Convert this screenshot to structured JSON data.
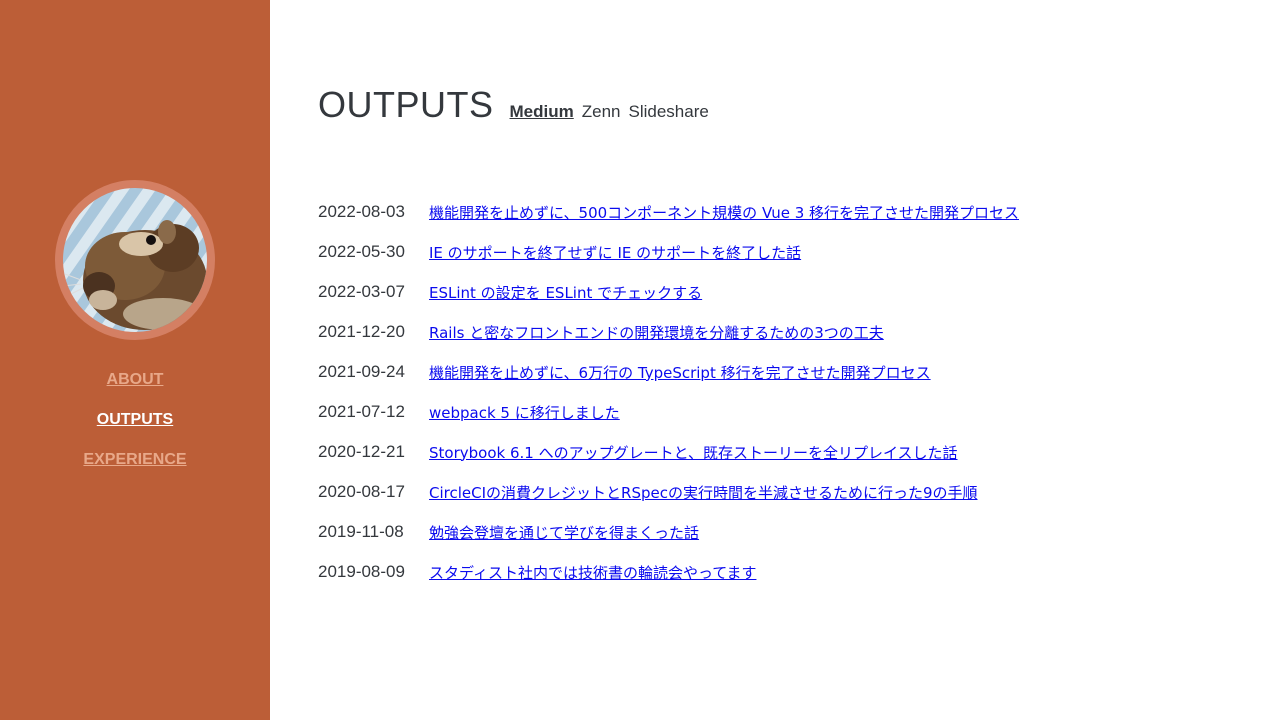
{
  "sidebar": {
    "avatar_alt": "avatar",
    "nav": [
      {
        "label": "ABOUT",
        "active": false
      },
      {
        "label": "OUTPUTS",
        "active": true
      },
      {
        "label": "EXPERIENCE",
        "active": false
      }
    ]
  },
  "main": {
    "title": "OUTPUTS",
    "sources": [
      {
        "label": "Medium",
        "active": true
      },
      {
        "label": "Zenn",
        "active": false
      },
      {
        "label": "Slideshare",
        "active": false
      }
    ],
    "posts": [
      {
        "date": "2022-08-03",
        "title": "機能開発を止めずに、500コンポーネント規模の Vue 3 移行を完了させた開発プロセス"
      },
      {
        "date": "2022-05-30",
        "title": "IE のサポートを終了せずに IE のサポートを終了した話"
      },
      {
        "date": "2022-03-07",
        "title": "ESLint の設定を ESLint でチェックする"
      },
      {
        "date": "2021-12-20",
        "title": "Rails と密なフロントエンドの開発環境を分離するための3つの工夫"
      },
      {
        "date": "2021-09-24",
        "title": "機能開発を止めずに、6万行の TypeScript 移行を完了させた開発プロセス"
      },
      {
        "date": "2021-07-12",
        "title": "webpack 5 に移行しました"
      },
      {
        "date": "2020-12-21",
        "title": "Storybook 6.1 へのアップグレートと、既存ストーリーを全リプレイスした話"
      },
      {
        "date": "2020-08-17",
        "title": "CircleCIの消費クレジットとRSpecの実行時間を半減させるために行った9の手順"
      },
      {
        "date": "2019-11-08",
        "title": "勉強会登壇を通じて学びを得まくった話"
      },
      {
        "date": "2019-08-09",
        "title": "スタディスト社内では技術書の輪読会やってます"
      }
    ]
  },
  "colors": {
    "sidebar_bg": "#bc5e37",
    "nav_inactive": "#e8a889",
    "nav_active": "#ffffff",
    "link": "#0b0bee",
    "text": "#34383d"
  }
}
